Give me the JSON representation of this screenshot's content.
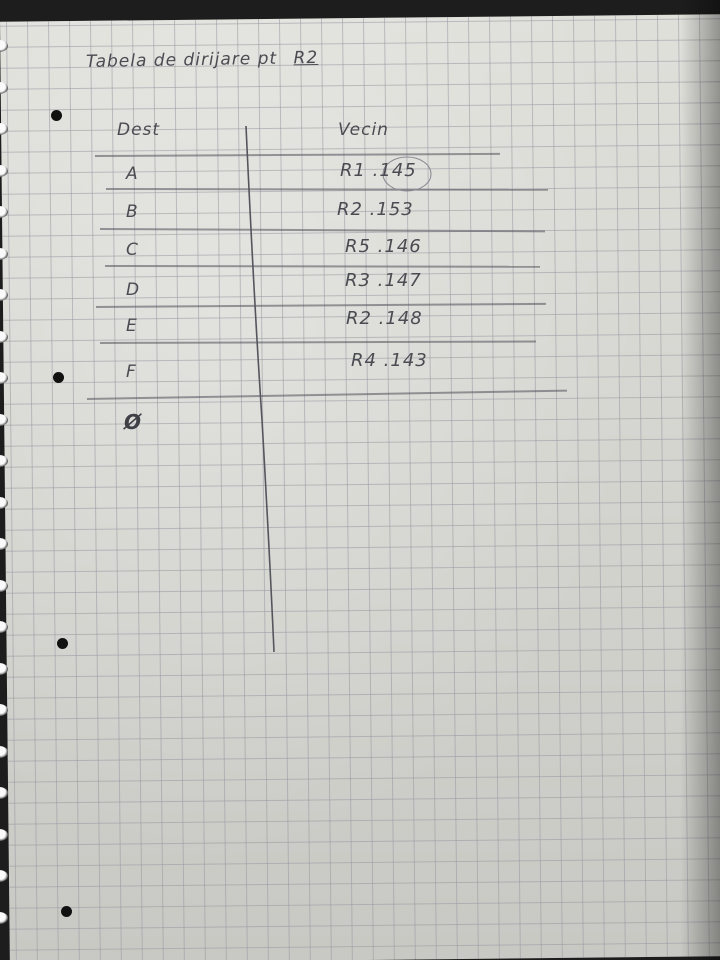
{
  "title": {
    "text": "Tabela de dirijare pt",
    "router": "R2"
  },
  "table": {
    "headers": {
      "destination": "Dest",
      "neighbor": "Vecin"
    },
    "rows": [
      {
        "dest": "A",
        "vecin": "R1 .145"
      },
      {
        "dest": "B",
        "vecin": "R2 .153"
      },
      {
        "dest": "C",
        "vecin": "R5 .146"
      },
      {
        "dest": "D",
        "vecin": "R3 .147"
      },
      {
        "dest": "E",
        "vecin": "R2 .148"
      },
      {
        "dest": "F",
        "vecin": "R4 .143"
      }
    ],
    "scribble": "Ø"
  },
  "colors": {
    "paper": "#e4e4df",
    "grid": "#9698a0",
    "pencil": "#4b4b52",
    "background": "#1d1d1d"
  }
}
